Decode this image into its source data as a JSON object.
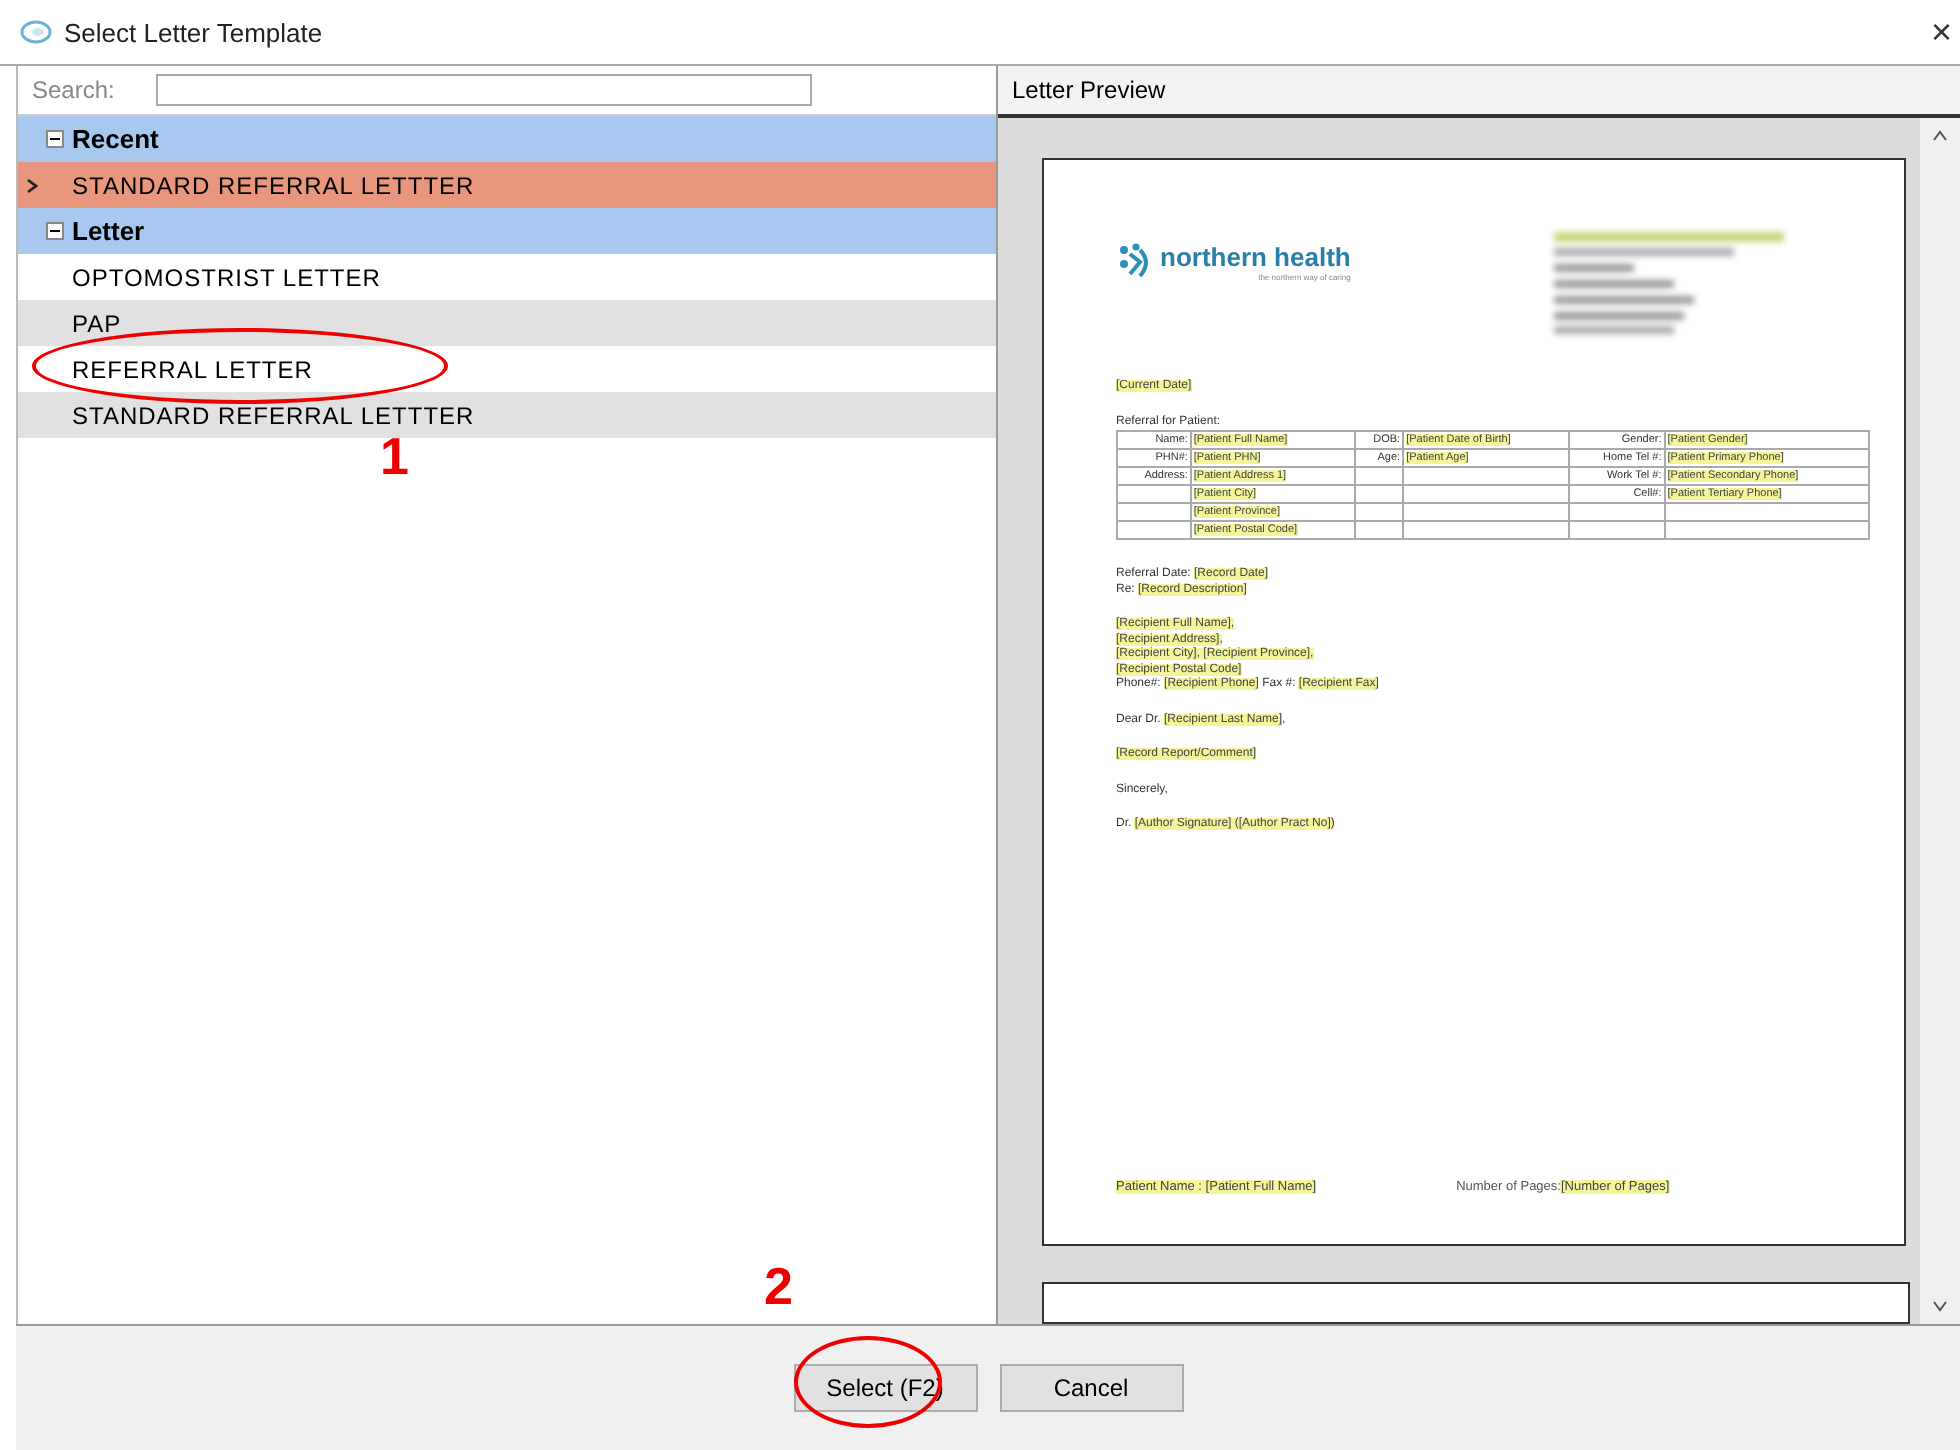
{
  "window": {
    "title": "Select Letter Template",
    "close": "×"
  },
  "search": {
    "label": "Search:"
  },
  "groups": [
    {
      "label": "Recent",
      "expanded": true,
      "items": [
        {
          "label": "STANDARD REFERRAL LETTTER",
          "selected": true
        }
      ]
    },
    {
      "label": "Letter",
      "expanded": true,
      "items": [
        {
          "label": "OPTOMOSTRIST LETTER",
          "selected": false
        },
        {
          "label": "PAP",
          "selected": false
        },
        {
          "label": "REFERRAL LETTER",
          "selected": false
        },
        {
          "label": "STANDARD REFERRAL LETTTER",
          "selected": false
        }
      ]
    }
  ],
  "preview": {
    "title": "Letter Preview",
    "logo": {
      "name": "northern health",
      "tagline": "the northern way of caring"
    },
    "date": "[Current Date]",
    "table_title": "Referral for Patient:",
    "table_rows": [
      [
        "Name:",
        "[Patient Full Name]",
        "DOB:",
        "[Patient Date of Birth]",
        "Gender:",
        "[Patient Gender]"
      ],
      [
        "PHN#:",
        "[Patient PHN]",
        "Age:",
        "[Patient Age]",
        "Home Tel #:",
        "[Patient Primary Phone]"
      ],
      [
        "Address:",
        "[Patient Address 1]",
        "",
        "",
        "Work Tel #:",
        "[Patient Secondary Phone]"
      ],
      [
        "",
        "[Patient City]",
        "",
        "",
        "Cell#:",
        "[Patient Tertiary Phone]"
      ],
      [
        "",
        "[Patient Province]",
        "",
        "",
        "",
        ""
      ],
      [
        "",
        "[Patient Postal Code]",
        "",
        "",
        "",
        ""
      ]
    ],
    "paragraphs": [
      [
        [
          {
            "text": "Referral Date: ",
            "highlight": false
          },
          {
            "text": "[Record Date]",
            "highlight": true
          }
        ],
        [
          {
            "text": "Re: ",
            "highlight": false
          },
          {
            "text": "[Record Description]",
            "highlight": true
          }
        ]
      ],
      [
        [
          {
            "text": "[Recipient Full Name],",
            "highlight": true
          }
        ],
        [
          {
            "text": "[Recipient Address],",
            "highlight": true
          }
        ],
        [
          {
            "text": "[Recipient City], [Recipient Province],",
            "highlight": true
          }
        ],
        [
          {
            "text": "[Recipient Postal Code]",
            "highlight": true
          }
        ],
        [
          {
            "text": "Phone#: ",
            "highlight": false
          },
          {
            "text": "[Recipient Phone]",
            "highlight": true
          },
          {
            "text": " Fax #: ",
            "highlight": false
          },
          {
            "text": "[Recipient Fax]",
            "highlight": true
          }
        ]
      ],
      [
        [
          {
            "text": "Dear Dr. ",
            "highlight": false
          },
          {
            "text": "[Recipient Last Name]",
            "highlight": true
          },
          {
            "text": ",",
            "highlight": false
          }
        ]
      ],
      [
        [
          {
            "text": "[Record Report/Comment]",
            "highlight": true
          }
        ]
      ],
      [
        [
          {
            "text": "Sincerely,",
            "highlight": false
          }
        ]
      ],
      [
        [
          {
            "text": "Dr. ",
            "highlight": false
          },
          {
            "text": "[Author Signature] ([Author Pract No])",
            "highlight": true
          }
        ]
      ]
    ],
    "footer": [
      [
        {
          "text": "Patient Name : [Patient Full Name]",
          "highlight": true
        }
      ],
      [
        {
          "text": "Number of Pages:",
          "highlight": false
        },
        {
          "text": "[Number of Pages]",
          "highlight": true
        }
      ]
    ]
  },
  "buttons": [
    {
      "label": "Select (F2)"
    },
    {
      "label": "Cancel"
    }
  ],
  "annotations": [
    {
      "label": "1"
    },
    {
      "label": "2"
    }
  ]
}
